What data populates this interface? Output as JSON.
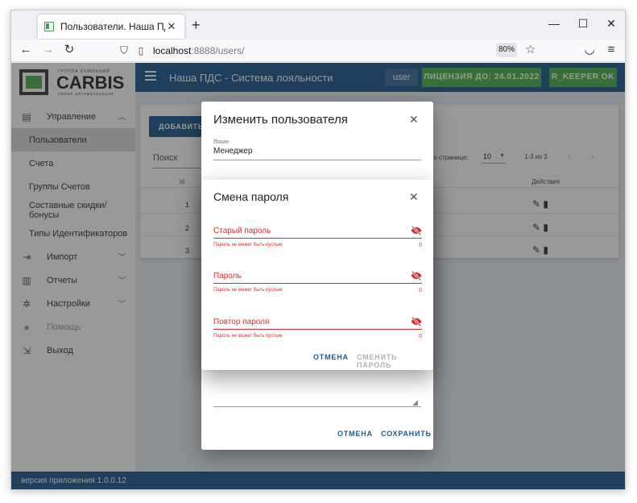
{
  "browser": {
    "tab_title": "Пользователи. Наша ПДС",
    "url_host": "localhost",
    "url_rest": ":8888/users/",
    "zoom": "80%"
  },
  "sidebar": {
    "logo": {
      "top_text": "ГРУППА КОМПАНИЙ",
      "name": "CARBIS",
      "sub_text": "умная автоматизация"
    },
    "items": [
      {
        "label": "Управление",
        "icon": "clipboard-icon",
        "arrow": "up"
      },
      {
        "label": "Пользователи",
        "active": true
      },
      {
        "label": "Счета"
      },
      {
        "label": "Группы Счетов"
      },
      {
        "label": "Составные скидки/бонусы"
      },
      {
        "label": "Типы Идентификаторов"
      },
      {
        "label": "Импорт",
        "icon": "import-icon",
        "arrow": "down"
      },
      {
        "label": "Отчеты",
        "icon": "chart-icon",
        "arrow": "down"
      },
      {
        "label": "Настройки",
        "icon": "gear-icon",
        "arrow": "down"
      },
      {
        "label": "Помощь",
        "icon": "help-icon",
        "disabled": true
      },
      {
        "label": "Выход",
        "icon": "logout-icon"
      }
    ]
  },
  "topbar": {
    "title": "Наша ПДС - Система лояльности",
    "user": "user",
    "license": "ЛИЦЕНЗИЯ ДО: 24.01.2022",
    "rkeeper": "R_KEEPER OK"
  },
  "users_table": {
    "add_button": "ДОБАВИТЬ",
    "search_label": "Поиск",
    "per_page_label": "по странице:",
    "per_page_value": "10",
    "range": "1-3 из 3",
    "col_id": "id",
    "col_actions": "Действия",
    "rows": [
      "1",
      "2",
      "3"
    ]
  },
  "edit_dialog": {
    "title": "Изменить пользователя",
    "login_label": "Логин",
    "login_value": "Менеджер",
    "cancel": "ОТМЕНА",
    "save": "СОХРАНИТЬ"
  },
  "password_dialog": {
    "title": "Смена пароля",
    "fields": [
      {
        "label": "Старый пароль",
        "error": "Пароль не может быть пустым",
        "count": "0"
      },
      {
        "label": "Пароль",
        "error": "Пароль не может быть пустым",
        "count": "0"
      },
      {
        "label": "Повтор пароля",
        "error": "Пароль не может быть пустым",
        "count": "0"
      }
    ],
    "cancel": "ОТМЕНА",
    "submit": "СМЕНИТЬ ПАРОЛЬ"
  },
  "footer": {
    "version": "версия приложения 1.0.0.12"
  },
  "colors": {
    "primary": "#1e5b8f",
    "success": "#4caf50",
    "error": "#d32f2f"
  }
}
